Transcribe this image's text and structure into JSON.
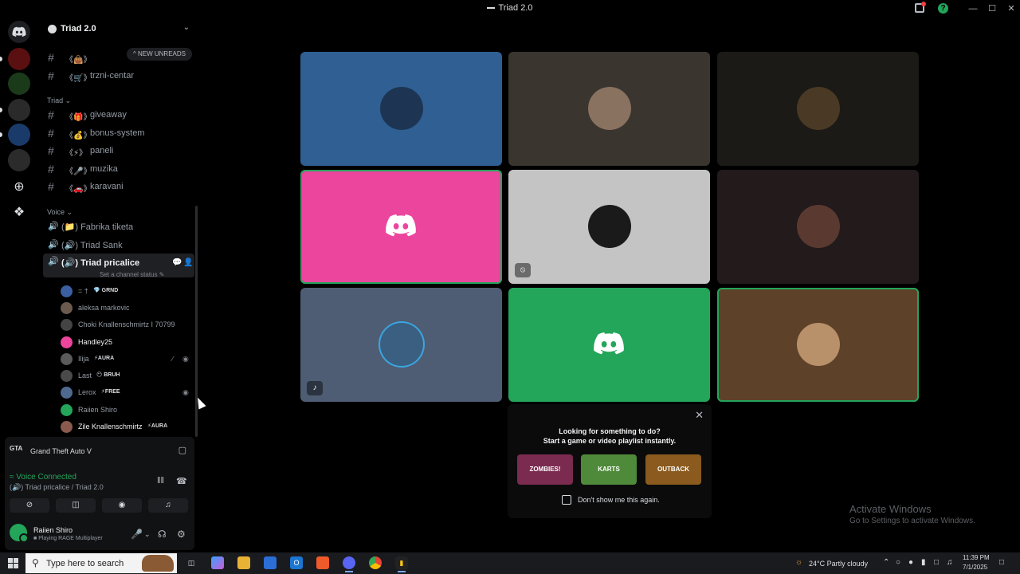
{
  "window": {
    "title": "Triad 2.0"
  },
  "server": {
    "name": "Triad 2.0",
    "new_unreads": "NEW UNREADS"
  },
  "channels_top": [
    {
      "emoji": "《👜》",
      "name": ""
    },
    {
      "emoji": "《🛒》",
      "name": "trzni-centar"
    }
  ],
  "category_triad": "Triad",
  "channels_triad": [
    {
      "emoji": "《🎁》",
      "name": "giveaway"
    },
    {
      "emoji": "《💰》",
      "name": "bonus-system"
    },
    {
      "emoji": "《⚡》",
      "name": "paneli"
    },
    {
      "emoji": "《🎤》",
      "name": "muzika"
    },
    {
      "emoji": "《🚗》",
      "name": "karavani"
    }
  ],
  "category_voice": "Voice",
  "voice_channels": [
    {
      "name": "(📁) Fabrika tiketa"
    },
    {
      "name": "(🔊) Triad Sank"
    },
    {
      "name": "(🔊) Triad pricalice"
    }
  ],
  "channel_status": "Set a channel status",
  "members": [
    {
      "name": "= †",
      "tag": "💎 GRND",
      "bright": false,
      "color": "#3b5fa0"
    },
    {
      "name": "aleksa markovic",
      "tag": "",
      "bright": false,
      "color": "#6b5a4e"
    },
    {
      "name": "Choki Knallenschmirtz I 70799",
      "tag": "",
      "bright": false,
      "color": "#444"
    },
    {
      "name": "Handley25",
      "tag": "",
      "bright": true,
      "color": "#eb459e"
    },
    {
      "name": "Ilija",
      "tag": "⚡AURA",
      "bright": false,
      "color": "#5a5a5a"
    },
    {
      "name": "Last",
      "tag": "😶 BRUH",
      "bright": false,
      "color": "#4a4a4a"
    },
    {
      "name": "Lerox",
      "tag": "⚡FREE",
      "bright": false,
      "color": "#4f6a8f"
    },
    {
      "name": "Raiien Shiro",
      "tag": "",
      "bright": false,
      "color": "#23a55a"
    },
    {
      "name": "Zile Knallenschmirtz",
      "tag": "⚡AURA",
      "bright": true,
      "color": "#8a5a4e"
    }
  ],
  "activity": {
    "icon": "GTA",
    "name": "Grand Theft Auto V"
  },
  "voice": {
    "status": "Voice Connected",
    "location": "(🔊) Triad pricalice / Triad 2.0"
  },
  "user": {
    "name": "Raiien Shiro",
    "status": "Playing RAGE Multiplayer"
  },
  "tiles": [
    {
      "bg": "#2f5f93",
      "type": "avatar",
      "av": "#1d3552",
      "speaking": false
    },
    {
      "bg": "#3a352f",
      "type": "avatar",
      "av": "#8a7260",
      "speaking": false
    },
    {
      "bg": "#1c1a16",
      "type": "avatar",
      "av": "#4a3a25",
      "speaking": false
    },
    {
      "bg": "#eb459e",
      "type": "discord",
      "speaking": true
    },
    {
      "bg": "#c4c4c4",
      "type": "avatar",
      "av": "#1a1a1a",
      "speaking": false
    },
    {
      "bg": "#231a1c",
      "type": "avatar",
      "av": "#5a3a30",
      "speaking": false
    },
    {
      "bg": "#4e5d73",
      "type": "avatar",
      "av": "#3b5f80",
      "speaking": false
    },
    {
      "bg": "#23a55a",
      "type": "discord",
      "speaking": false
    },
    {
      "bg": "#5e4129",
      "type": "avatar",
      "av": "#b8906a",
      "speaking": true
    }
  ],
  "popup": {
    "line1": "Looking for something to do?",
    "line2": "Start a game or video playlist instantly.",
    "games": [
      {
        "label": "ZOMBIES!",
        "color": "#7a2b4f"
      },
      {
        "label": "KARTS",
        "color": "#4f8a3a"
      },
      {
        "label": "OUTBACK",
        "color": "#8a5a1e"
      }
    ],
    "checkbox_label": "Don't show me this again."
  },
  "watermark": {
    "title": "Activate Windows",
    "subtitle": "Go to Settings to activate Windows."
  },
  "taskbar": {
    "search_placeholder": "Type here to search",
    "weather": "24°C  Partly cloudy",
    "time": "11:39 PM",
    "date": "7/1/2025"
  }
}
